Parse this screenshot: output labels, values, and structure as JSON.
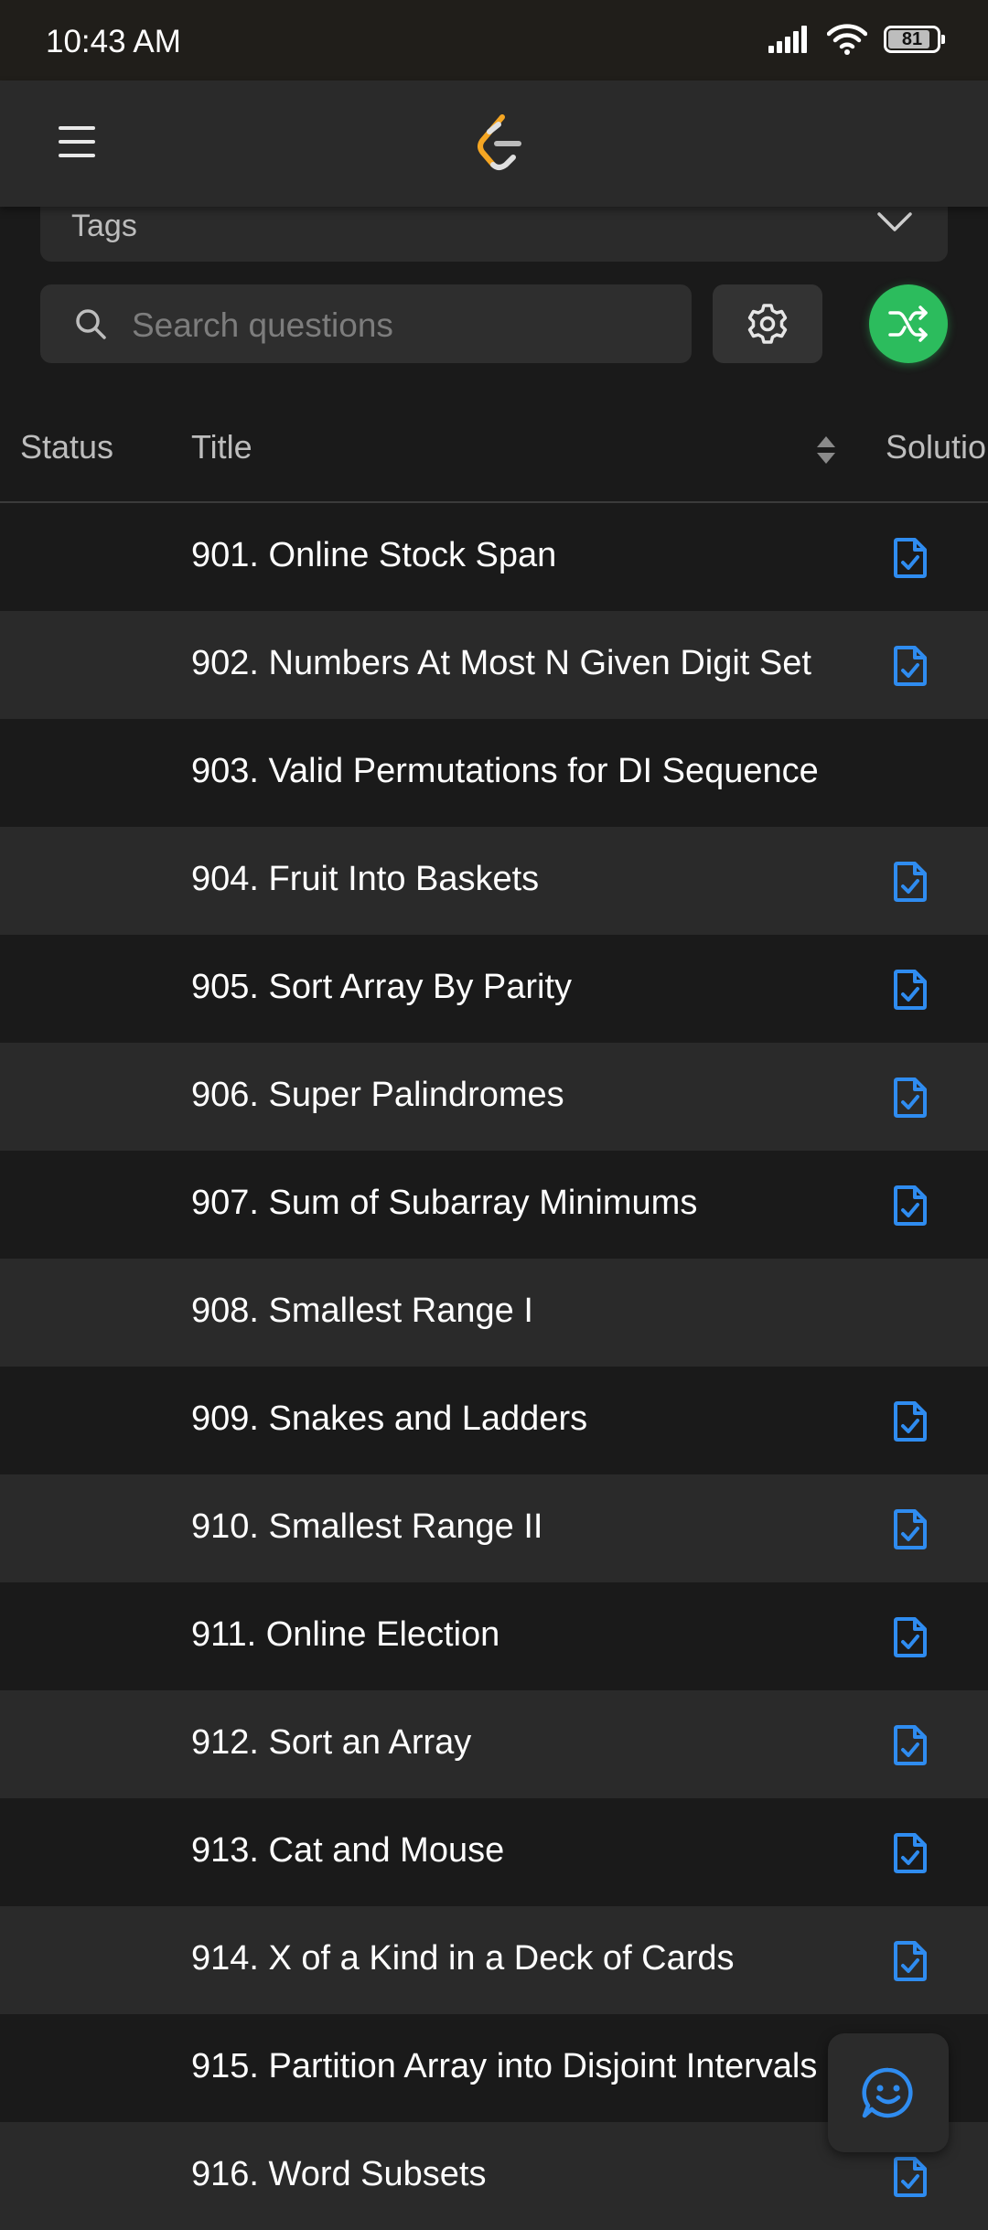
{
  "status_bar": {
    "time": "10:43 AM",
    "battery": "81"
  },
  "filters": {
    "tags_label": "Tags",
    "search_placeholder": "Search questions"
  },
  "table": {
    "headers": {
      "status": "Status",
      "title": "Title",
      "solution": "Solutio"
    },
    "rows": [
      {
        "title": "901. Online Stock Span",
        "has_solution": true
      },
      {
        "title": "902. Numbers At Most N Given Digit Set",
        "has_solution": true
      },
      {
        "title": "903. Valid Permutations for DI Sequence",
        "has_solution": false
      },
      {
        "title": "904. Fruit Into Baskets",
        "has_solution": true
      },
      {
        "title": "905. Sort Array By Parity",
        "has_solution": true
      },
      {
        "title": "906. Super Palindromes",
        "has_solution": true
      },
      {
        "title": "907. Sum of Subarray Minimums",
        "has_solution": true
      },
      {
        "title": "908. Smallest Range I",
        "has_solution": false
      },
      {
        "title": "909. Snakes and Ladders",
        "has_solution": true
      },
      {
        "title": "910. Smallest Range II",
        "has_solution": true
      },
      {
        "title": "911. Online Election",
        "has_solution": true
      },
      {
        "title": "912. Sort an Array",
        "has_solution": true
      },
      {
        "title": "913. Cat and Mouse",
        "has_solution": true
      },
      {
        "title": "914. X of a Kind in a Deck of Cards",
        "has_solution": true
      },
      {
        "title": "915. Partition Array into Disjoint Intervals",
        "has_solution": false
      },
      {
        "title": "916. Word Subsets",
        "has_solution": true
      }
    ]
  },
  "colors": {
    "accent_green": "#2cbc5d",
    "solution_blue": "#2f8cf0",
    "logo_orange": "#f5a623"
  },
  "icons": [
    "signal-icon",
    "wifi-icon",
    "battery-icon",
    "menu-icon",
    "leetcode-logo",
    "chevron-down-icon",
    "search-icon",
    "gear-icon",
    "shuffle-icon",
    "sort-icon",
    "solution-icon",
    "chat-smile-icon"
  ]
}
